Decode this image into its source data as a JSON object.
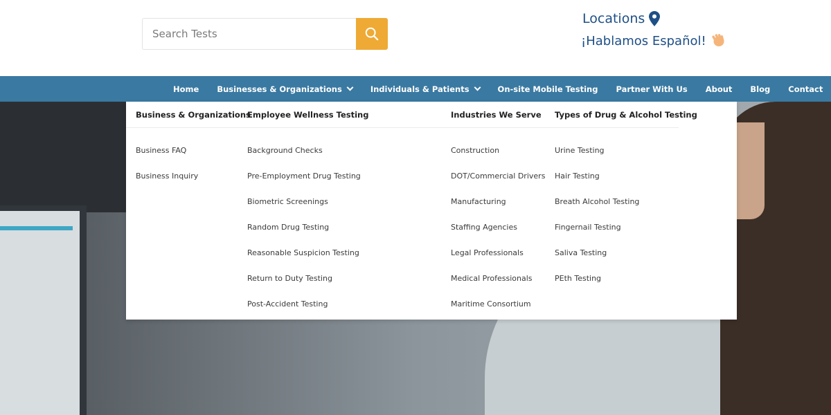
{
  "header": {
    "search_placeholder": "Search Tests",
    "locations_label": "Locations",
    "spanish_label": "¡Hablamos Español!"
  },
  "nav": {
    "items": [
      {
        "label": "Home"
      },
      {
        "label": "Businesses & Organizations"
      },
      {
        "label": "Individuals & Patients"
      },
      {
        "label": "On-site Mobile Testing"
      },
      {
        "label": "Partner With Us"
      },
      {
        "label": "About"
      },
      {
        "label": "Blog"
      },
      {
        "label": "Contact"
      }
    ]
  },
  "mega_menu": {
    "columns": [
      {
        "heading": "Business & Organizations",
        "links": [
          "Business FAQ",
          "Business Inquiry"
        ]
      },
      {
        "heading": "Employee Wellness Testing",
        "links": [
          "Background Checks",
          "Pre-Employment Drug Testing",
          "Biometric Screenings",
          "Random Drug Testing",
          "Reasonable Suspicion Testing",
          "Return to Duty Testing",
          "Post-Accident Testing"
        ]
      },
      {
        "heading": "Industries We Serve",
        "links": [
          "Construction",
          "DOT/Commercial Drivers",
          "Manufacturing",
          "Staffing Agencies",
          "Legal Professionals",
          "Medical Professionals",
          "Maritime Consortium"
        ]
      },
      {
        "heading": "Types of Drug & Alcohol Testing",
        "links": [
          "Urine Testing",
          "Hair Testing",
          "Breath Alcohol Testing",
          "Fingernail Testing",
          "Saliva Testing",
          "PEth Testing"
        ]
      }
    ]
  },
  "colors": {
    "nav_background": "#3a79a1",
    "search_button": "#eeaa35",
    "link_blue": "#1e4f86"
  },
  "icons": {
    "search": "search-icon",
    "location": "map-pin-icon",
    "wave": "waving-hand-icon",
    "dropdown": "chevron-down-icon"
  }
}
